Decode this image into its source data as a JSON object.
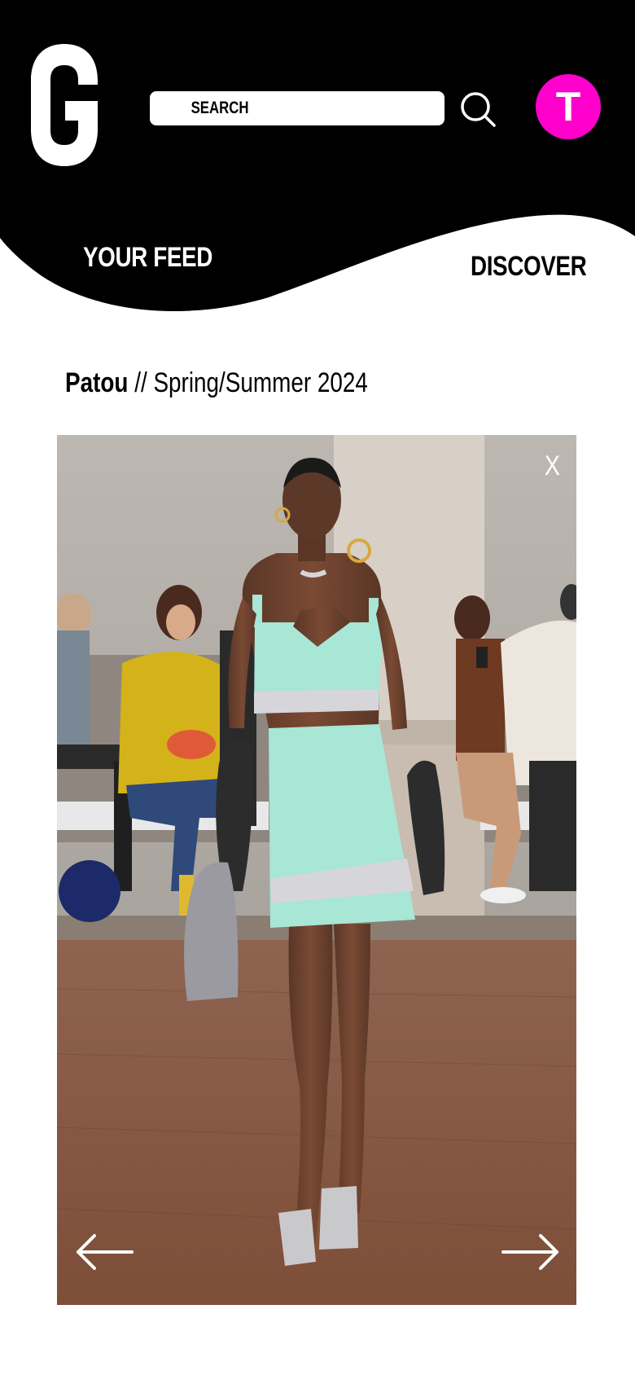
{
  "header": {
    "logo_letter": "G",
    "search": {
      "placeholder": "SEARCH",
      "value": ""
    },
    "search_icon": "search-icon",
    "avatar": {
      "initial": "T",
      "color": "#ff00cc"
    }
  },
  "nav": {
    "tabs": [
      {
        "label": "YOUR FEED",
        "active": true
      },
      {
        "label": "DISCOVER",
        "active": false
      }
    ]
  },
  "collection": {
    "designer": "Patou",
    "separator": "//",
    "season": "Spring/Summer 2024"
  },
  "viewer": {
    "close_label": "X",
    "prev_icon": "arrow-left-icon",
    "next_icon": "arrow-right-icon",
    "image_description_colors": {
      "outfit": "#a8e6d6",
      "floor": "#8a5a42",
      "wall": "#b9b3ad"
    }
  }
}
